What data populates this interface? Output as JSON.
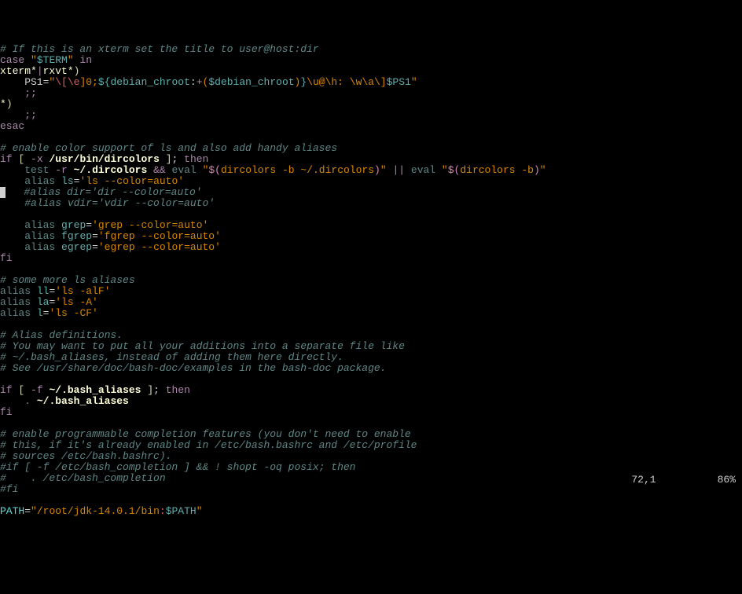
{
  "lines": [
    {
      "seg": [
        {
          "t": "# If this is an xterm set the title to user@host:dir",
          "c": "c-comment"
        }
      ]
    },
    {
      "seg": [
        {
          "t": "case",
          "c": "c-keyword"
        },
        {
          "t": " ",
          "c": "c-white"
        },
        {
          "t": "\"",
          "c": "c-string"
        },
        {
          "t": "$TERM",
          "c": "c-variable"
        },
        {
          "t": "\"",
          "c": "c-string"
        },
        {
          "t": " ",
          "c": "c-white"
        },
        {
          "t": "in",
          "c": "c-keyword"
        }
      ]
    },
    {
      "seg": [
        {
          "t": "xterm*",
          "c": "c-path-light"
        },
        {
          "t": "|",
          "c": "c-keyword"
        },
        {
          "t": "rxvt*",
          "c": "c-path-light"
        },
        {
          "t": ")",
          "c": "c-op"
        }
      ]
    },
    {
      "seg": [
        {
          "t": "    PS1",
          "c": "c-white"
        },
        {
          "t": "=",
          "c": "c-white"
        },
        {
          "t": "\"",
          "c": "c-string"
        },
        {
          "t": "\\[\\e",
          "c": "c-red"
        },
        {
          "t": "]0;",
          "c": "c-string"
        },
        {
          "t": "${debian_chroot",
          "c": "c-variable"
        },
        {
          "t": ":",
          "c": "c-white"
        },
        {
          "t": "+",
          "c": "c-keyword"
        },
        {
          "t": "(",
          "c": "c-string"
        },
        {
          "t": "$debian_chroot",
          "c": "c-variable"
        },
        {
          "t": ")",
          "c": "c-string"
        },
        {
          "t": "}",
          "c": "c-variable"
        },
        {
          "t": "\\u@\\h: \\w\\a\\]",
          "c": "c-string"
        },
        {
          "t": "$PS1",
          "c": "c-variable"
        },
        {
          "t": "\"",
          "c": "c-string"
        }
      ]
    },
    {
      "seg": [
        {
          "t": "    ;;",
          "c": "c-keyword"
        }
      ]
    },
    {
      "seg": [
        {
          "t": "*",
          "c": "c-path-light"
        },
        {
          "t": ")",
          "c": "c-op"
        }
      ]
    },
    {
      "seg": [
        {
          "t": "    ;;",
          "c": "c-keyword"
        }
      ]
    },
    {
      "seg": [
        {
          "t": "esac",
          "c": "c-keyword"
        }
      ]
    },
    {
      "seg": []
    },
    {
      "seg": [
        {
          "t": "# enable color support of ls and also add handy aliases",
          "c": "c-comment"
        }
      ]
    },
    {
      "seg": [
        {
          "t": "if",
          "c": "c-keyword"
        },
        {
          "t": " ",
          "c": "c-white"
        },
        {
          "t": "[",
          "c": "c-op"
        },
        {
          "t": " ",
          "c": "c-white"
        },
        {
          "t": "-x",
          "c": "c-keyword"
        },
        {
          "t": " ",
          "c": "c-white"
        },
        {
          "t": "/usr/bin/dircolors",
          "c": "c-path-light",
          "b": true
        },
        {
          "t": " ",
          "c": "c-white"
        },
        {
          "t": "]",
          "c": "c-op"
        },
        {
          "t": ";",
          "c": "c-white"
        },
        {
          "t": " ",
          "c": "c-white"
        },
        {
          "t": "then",
          "c": "c-keyword"
        }
      ]
    },
    {
      "seg": [
        {
          "t": "    ",
          "c": "c-white"
        },
        {
          "t": "test",
          "c": "c-builtin"
        },
        {
          "t": " ",
          "c": "c-white"
        },
        {
          "t": "-r",
          "c": "c-keyword"
        },
        {
          "t": " ",
          "c": "c-white"
        },
        {
          "t": "~/.dircolors",
          "c": "c-path-light",
          "b": true
        },
        {
          "t": " ",
          "c": "c-white"
        },
        {
          "t": "&&",
          "c": "c-keyword"
        },
        {
          "t": " ",
          "c": "c-white"
        },
        {
          "t": "eval",
          "c": "c-builtin"
        },
        {
          "t": " ",
          "c": "c-white"
        },
        {
          "t": "\"",
          "c": "c-string"
        },
        {
          "t": "$(",
          "c": "c-magenta"
        },
        {
          "t": "dircolors -b ~/.dircolors",
          "c": "c-string"
        },
        {
          "t": ")",
          "c": "c-magenta"
        },
        {
          "t": "\"",
          "c": "c-string"
        },
        {
          "t": " ",
          "c": "c-white"
        },
        {
          "t": "||",
          "c": "c-keyword"
        },
        {
          "t": " ",
          "c": "c-white"
        },
        {
          "t": "eval",
          "c": "c-builtin"
        },
        {
          "t": " ",
          "c": "c-white"
        },
        {
          "t": "\"",
          "c": "c-string"
        },
        {
          "t": "$(",
          "c": "c-magenta"
        },
        {
          "t": "dircolors -b",
          "c": "c-string"
        },
        {
          "t": ")",
          "c": "c-magenta"
        },
        {
          "t": "\"",
          "c": "c-string"
        }
      ]
    },
    {
      "seg": [
        {
          "t": "    ",
          "c": "c-white"
        },
        {
          "t": "alias",
          "c": "c-builtin"
        },
        {
          "t": " ",
          "c": "c-white"
        },
        {
          "t": "ls",
          "c": "c-variable"
        },
        {
          "t": "=",
          "c": "c-white"
        },
        {
          "t": "'ls --color=auto'",
          "c": "c-string"
        }
      ]
    },
    {
      "seg": [
        {
          "t": "",
          "c": "cursor-block"
        },
        {
          "t": "   ",
          "c": "c-white"
        },
        {
          "t": "#alias dir='dir --color=auto'",
          "c": "c-comment"
        }
      ]
    },
    {
      "seg": [
        {
          "t": "    ",
          "c": "c-white"
        },
        {
          "t": "#alias vdir='vdir --color=auto'",
          "c": "c-comment"
        }
      ]
    },
    {
      "seg": []
    },
    {
      "seg": [
        {
          "t": "    ",
          "c": "c-white"
        },
        {
          "t": "alias",
          "c": "c-builtin"
        },
        {
          "t": " ",
          "c": "c-white"
        },
        {
          "t": "grep",
          "c": "c-variable"
        },
        {
          "t": "=",
          "c": "c-white"
        },
        {
          "t": "'grep --color=auto'",
          "c": "c-string"
        }
      ]
    },
    {
      "seg": [
        {
          "t": "    ",
          "c": "c-white"
        },
        {
          "t": "alias",
          "c": "c-builtin"
        },
        {
          "t": " ",
          "c": "c-white"
        },
        {
          "t": "fgrep",
          "c": "c-variable"
        },
        {
          "t": "=",
          "c": "c-white"
        },
        {
          "t": "'fgrep --color=auto'",
          "c": "c-string"
        }
      ]
    },
    {
      "seg": [
        {
          "t": "    ",
          "c": "c-white"
        },
        {
          "t": "alias",
          "c": "c-builtin"
        },
        {
          "t": " ",
          "c": "c-white"
        },
        {
          "t": "egrep",
          "c": "c-variable"
        },
        {
          "t": "=",
          "c": "c-white"
        },
        {
          "t": "'egrep --color=auto'",
          "c": "c-string"
        }
      ]
    },
    {
      "seg": [
        {
          "t": "fi",
          "c": "c-keyword"
        }
      ]
    },
    {
      "seg": []
    },
    {
      "seg": [
        {
          "t": "# some more ls aliases",
          "c": "c-comment"
        }
      ]
    },
    {
      "seg": [
        {
          "t": "alias",
          "c": "c-builtin"
        },
        {
          "t": " ",
          "c": "c-white"
        },
        {
          "t": "ll",
          "c": "c-variable"
        },
        {
          "t": "=",
          "c": "c-white"
        },
        {
          "t": "'ls -alF'",
          "c": "c-string"
        }
      ]
    },
    {
      "seg": [
        {
          "t": "alias",
          "c": "c-builtin"
        },
        {
          "t": " ",
          "c": "c-white"
        },
        {
          "t": "la",
          "c": "c-variable"
        },
        {
          "t": "=",
          "c": "c-white"
        },
        {
          "t": "'ls -A'",
          "c": "c-string"
        }
      ]
    },
    {
      "seg": [
        {
          "t": "alias",
          "c": "c-builtin"
        },
        {
          "t": " ",
          "c": "c-white"
        },
        {
          "t": "l",
          "c": "c-variable"
        },
        {
          "t": "=",
          "c": "c-white"
        },
        {
          "t": "'ls -CF'",
          "c": "c-string"
        }
      ]
    },
    {
      "seg": []
    },
    {
      "seg": [
        {
          "t": "# Alias definitions.",
          "c": "c-comment"
        }
      ]
    },
    {
      "seg": [
        {
          "t": "# You may want to put all your additions into a separate file like",
          "c": "c-comment"
        }
      ]
    },
    {
      "seg": [
        {
          "t": "# ~/.bash_aliases, instead of adding them here directly.",
          "c": "c-comment"
        }
      ]
    },
    {
      "seg": [
        {
          "t": "# See /usr/share/doc/bash-doc/examples in the bash-doc package.",
          "c": "c-comment"
        }
      ]
    },
    {
      "seg": []
    },
    {
      "seg": [
        {
          "t": "if",
          "c": "c-keyword"
        },
        {
          "t": " ",
          "c": "c-white"
        },
        {
          "t": "[",
          "c": "c-op"
        },
        {
          "t": " ",
          "c": "c-white"
        },
        {
          "t": "-f",
          "c": "c-keyword"
        },
        {
          "t": " ",
          "c": "c-white"
        },
        {
          "t": "~/.bash_aliases",
          "c": "c-path-light",
          "b": true
        },
        {
          "t": " ",
          "c": "c-white"
        },
        {
          "t": "]",
          "c": "c-op"
        },
        {
          "t": ";",
          "c": "c-white"
        },
        {
          "t": " ",
          "c": "c-white"
        },
        {
          "t": "then",
          "c": "c-keyword"
        }
      ]
    },
    {
      "seg": [
        {
          "t": "    ",
          "c": "c-white"
        },
        {
          "t": ".",
          "c": "c-builtin"
        },
        {
          "t": " ",
          "c": "c-white"
        },
        {
          "t": "~/.bash_aliases",
          "c": "c-path-light",
          "b": true
        }
      ]
    },
    {
      "seg": [
        {
          "t": "fi",
          "c": "c-keyword"
        }
      ]
    },
    {
      "seg": []
    },
    {
      "seg": [
        {
          "t": "# enable programmable completion features (you don't need to enable",
          "c": "c-comment"
        }
      ]
    },
    {
      "seg": [
        {
          "t": "# this, if it's already enabled in /etc/bash.bashrc and /etc/profile",
          "c": "c-comment"
        }
      ]
    },
    {
      "seg": [
        {
          "t": "# sources /etc/bash.bashrc).",
          "c": "c-comment"
        }
      ]
    },
    {
      "seg": [
        {
          "t": "#if [ -f /etc/bash_completion ] && ! shopt -oq posix; then",
          "c": "c-comment"
        }
      ]
    },
    {
      "seg": [
        {
          "t": "#    . /etc/bash_completion",
          "c": "c-comment"
        }
      ]
    },
    {
      "seg": [
        {
          "t": "#fi",
          "c": "c-comment"
        }
      ]
    },
    {
      "seg": []
    },
    {
      "seg": [
        {
          "t": "PATH",
          "c": "c-cyan"
        },
        {
          "t": "=",
          "c": "c-white"
        },
        {
          "t": "\"",
          "c": "c-string"
        },
        {
          "t": "/root/jdk-14.0.1/bin",
          "c": "c-string"
        },
        {
          "t": ":",
          "c": "c-red"
        },
        {
          "t": "$PATH",
          "c": "c-variable"
        },
        {
          "t": "\"",
          "c": "c-string"
        }
      ]
    }
  ],
  "status": {
    "position": "72,1",
    "scroll": "86%"
  }
}
